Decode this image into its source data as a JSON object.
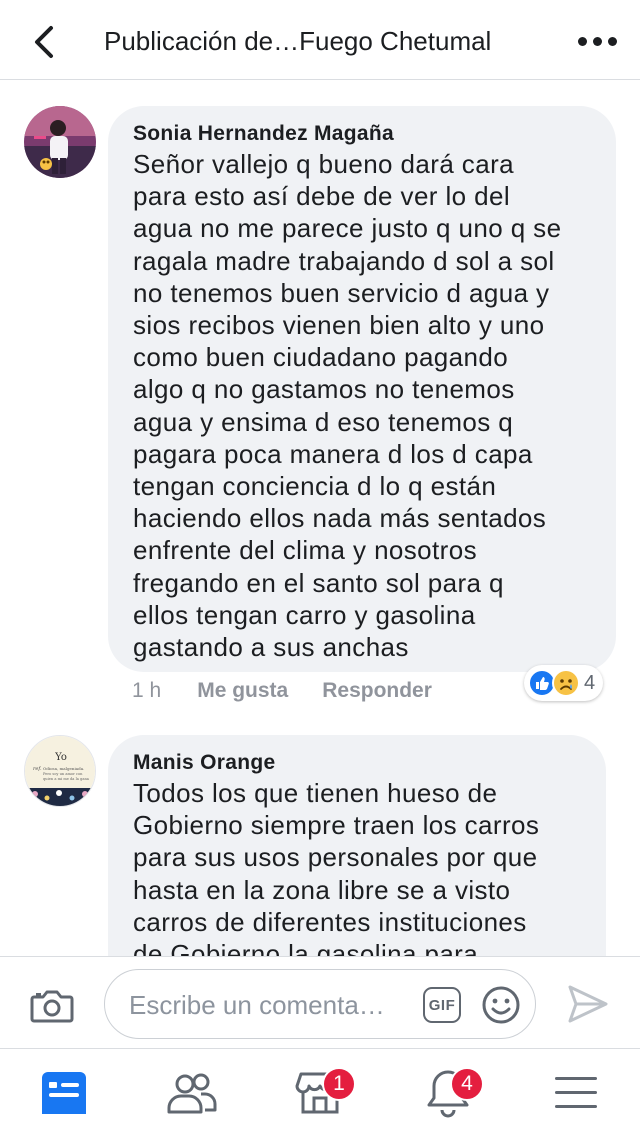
{
  "header": {
    "title": "Publicación de…Fuego Chetumal",
    "back_icon": "chevron-left-icon",
    "more_icon": "more-horizontal-icon"
  },
  "comments": [
    {
      "author": "Sonia Hernandez Magaña",
      "lines": [
        "Señor vallejo q bueno dará cara",
        "para esto así debe de ver lo del",
        "agua no me parece justo q uno q se",
        "ragala madre trabajando d sol a sol",
        "no tenemos buen servicio d agua y",
        "sios recibos vienen bien alto y uno",
        "como buen ciudadano pagando",
        "algo q no gastamos no tenemos",
        "agua y ensima d eso tenemos q",
        "pagara poca manera d los d capa",
        "tengan conciencia d lo q están",
        "haciendo ellos nada más sentados",
        "enfrente del clima y nosotros",
        "fregando en el santo sol para q",
        "ellos tengan carro y gasolina",
        "gastando a sus anchas"
      ],
      "time": "1 h",
      "like_label": "Me gusta",
      "reply_label": "Responder",
      "reactions": {
        "types": [
          "like-reaction-icon",
          "sad-reaction-icon"
        ],
        "count": "4"
      }
    },
    {
      "author": "Manis Orange",
      "avatar_text": {
        "title": "Yo",
        "prefix": "ref.",
        "line1": "Odiosa, malgeniada.",
        "line2": "Pero soy un amor con",
        "line3": "quien a mi me da la gana"
      },
      "lines": [
        "Todos los que tienen hueso de",
        "Gobierno siempre traen los carros",
        "para sus usos personales por que",
        "hasta en la zona libre se a visto",
        "carros de diferentes instituciones",
        "de Gobierno la gasolina para"
      ]
    }
  ],
  "composer": {
    "placeholder": "Escribe un comenta…",
    "gif_label": "GIF",
    "camera_icon": "camera-icon",
    "emoji_icon": "smiley-icon",
    "send_icon": "send-icon"
  },
  "bottom_nav": {
    "items": [
      {
        "name": "news-feed",
        "icon": "news-feed-icon",
        "badge": "",
        "active": true
      },
      {
        "name": "friends",
        "icon": "friends-icon",
        "badge": ""
      },
      {
        "name": "marketplace",
        "icon": "marketplace-icon",
        "badge": "1"
      },
      {
        "name": "notifications",
        "icon": "bell-icon",
        "badge": "4"
      },
      {
        "name": "menu",
        "icon": "menu-icon",
        "badge": ""
      }
    ]
  },
  "colors": {
    "accent": "#1877f2",
    "bubble": "#f0f2f5",
    "meta_text": "#90949c",
    "badge": "#e41e3f",
    "icon_gray": "#606770"
  }
}
